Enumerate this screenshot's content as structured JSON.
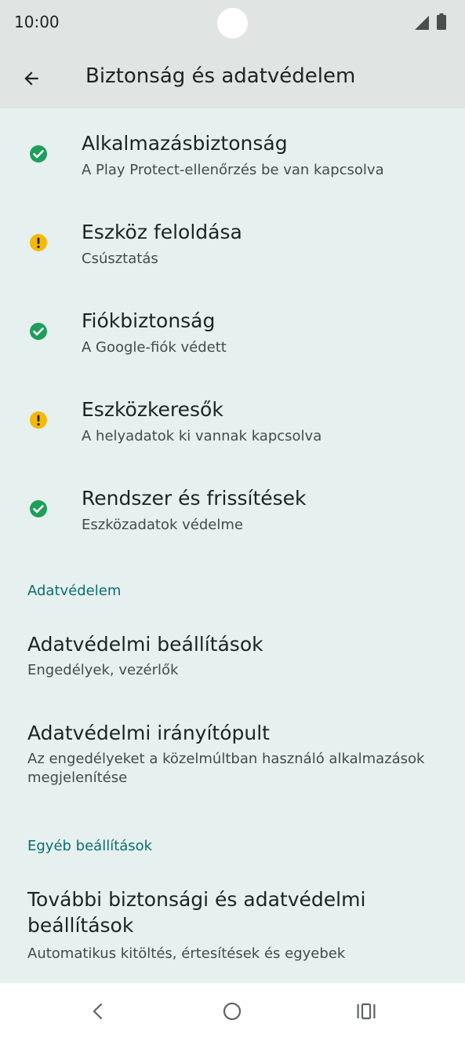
{
  "status_bar": {
    "time": "10:00"
  },
  "app_bar": {
    "title": "Biztonság és adatvédelem"
  },
  "colors": {
    "ok": "#1e9e5a",
    "warning": "#f6b800",
    "section_header": "#0b6d72",
    "background": "#e6f0ee"
  },
  "security_items": [
    {
      "title": "Alkalmazásbiztonság",
      "subtitle": "A Play Protect-ellenőrzés be van kapcsolva",
      "status_icon": "check-circle-icon"
    },
    {
      "title": "Eszköz feloldása",
      "subtitle": "Csúsztatás",
      "status_icon": "warning-circle-icon"
    },
    {
      "title": "Fiókbiztonság",
      "subtitle": "A Google-fiók védett",
      "status_icon": "check-circle-icon"
    },
    {
      "title": "Eszközkeresők",
      "subtitle": "A helyadatok ki vannak kapcsolva",
      "status_icon": "warning-circle-icon"
    },
    {
      "title": "Rendszer és frissítések",
      "subtitle": "Eszközadatok védelme",
      "status_icon": "check-circle-icon"
    }
  ],
  "privacy_section": {
    "header": "Adatvédelem",
    "items": [
      {
        "title": "Adatvédelmi beállítások",
        "subtitle": "Engedélyek, vezérlők"
      },
      {
        "title": "Adatvédelmi irányítópult",
        "subtitle": "Az engedélyeket a közelmúltban használó alkalmazások megjelenítése"
      }
    ]
  },
  "other_section": {
    "header": "Egyéb beállítások",
    "items": [
      {
        "title": "További biztonsági és adatvédelmi beállítások",
        "subtitle": "Automatikus kitöltés, értesítések és egyebek"
      }
    ]
  },
  "nav_bar": {
    "icons": [
      "back-nav-icon",
      "home-nav-icon",
      "recents-nav-icon"
    ]
  }
}
